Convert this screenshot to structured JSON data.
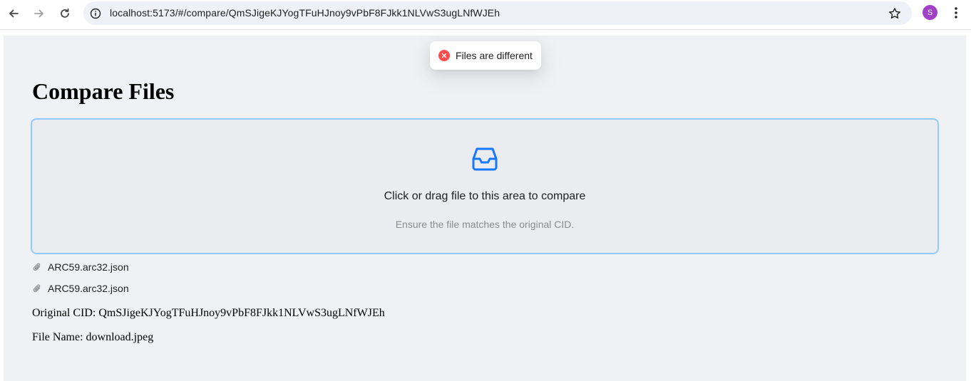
{
  "browser": {
    "url": "localhost:5173/#/compare/QmSJigeKJYogTFuHJnoy9vPbF8FJkk1NLVwS3ugLNfWJEh",
    "avatar_letter": "S",
    "icons": {
      "back": "arrow-left-icon",
      "forward": "arrow-right-icon",
      "reload": "reload-icon",
      "site_info": "info-icon",
      "bookmark": "star-icon",
      "menu": "kebab-menu-icon"
    }
  },
  "toast": {
    "message": "Files are different",
    "icon": "error-circle-icon",
    "color": "#ff4d4f"
  },
  "main": {
    "title": "Compare Files",
    "upload": {
      "icon": "inbox-icon",
      "text": "Click or drag file to this area to compare",
      "hint": "Ensure the file matches the original CID.",
      "accent": "#1677ff",
      "border_color": "#91caff"
    },
    "files": [
      {
        "name": "ARC59.arc32.json",
        "icon": "paperclip-icon"
      },
      {
        "name": "ARC59.arc32.json",
        "icon": "paperclip-icon"
      }
    ],
    "original_cid": "Original CID: QmSJigeKJYogTFuHJnoy9vPbF8FJkk1NLVwS3ugLNfWJEh",
    "file_name": "File Name: download.jpeg"
  }
}
